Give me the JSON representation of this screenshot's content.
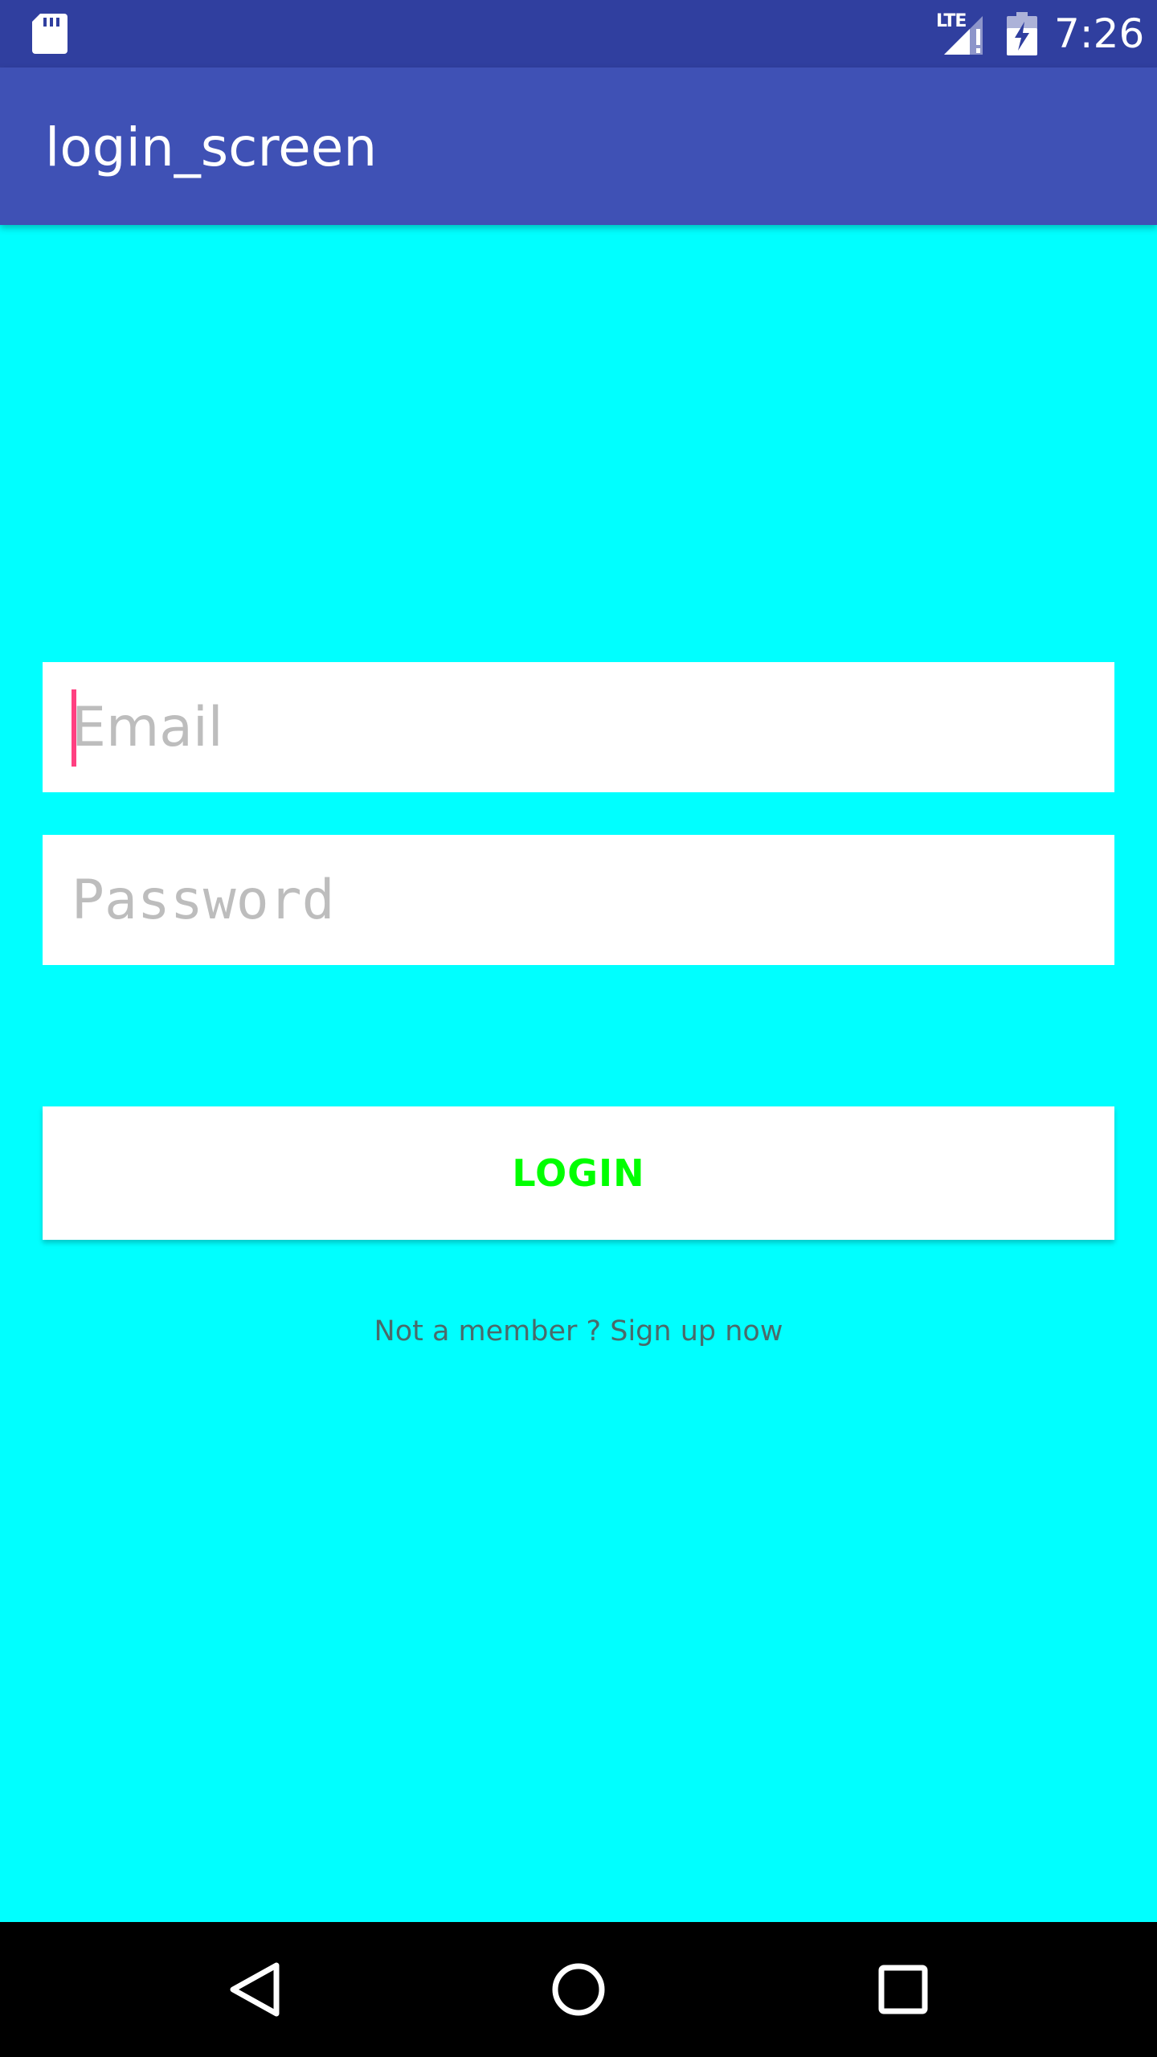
{
  "status_bar": {
    "network_type": "LTE",
    "time": "7:26",
    "icons": [
      "sd-card-icon",
      "signal-icon",
      "battery-charging-icon"
    ]
  },
  "app_bar": {
    "title": "login_screen"
  },
  "form": {
    "email_placeholder": "Email",
    "email_value": "",
    "password_placeholder": "Password",
    "password_value": "",
    "login_label": "LOGIN",
    "signup_text": "Not a member ? Sign up now"
  },
  "nav_bar": {
    "icons": [
      "back-icon",
      "home-icon",
      "recent-apps-icon"
    ]
  },
  "colors": {
    "status_bar": "#303F9F",
    "app_bar": "#3F51B5",
    "background": "#00FFFF",
    "login_text": "#00FF00",
    "caret": "#FF4081"
  }
}
